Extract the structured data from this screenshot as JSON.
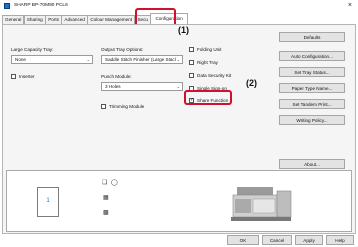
{
  "window": {
    "title": "SHARP BP-70M90 PCL6",
    "close": "×"
  },
  "tabs": [
    "General",
    "Sharing",
    "Ports",
    "Advanced",
    "Colour Management",
    "Secu",
    "Configuration"
  ],
  "left": {
    "large_capacity_label": "Large Capacity Tray:",
    "large_capacity_value": "None",
    "inserter_label": "Inserter"
  },
  "middle": {
    "output_label": "Output Tray Options:",
    "output_value": "Saddle Stitch Finisher (Large Stacl",
    "punch_label": "Punch Module:",
    "punch_value": "3 Holes",
    "trimming_label": "Trimming Module"
  },
  "checks": {
    "folding_unit": "Folding Unit",
    "right_tray": "Right Tray",
    "data_security": "Data Security Kit",
    "single_sign_on": "Single Sign-on",
    "share_function": "Share Function"
  },
  "buttons": {
    "defaults": "Defaults",
    "auto_config": "Auto Configuration...",
    "tray_status": "Set Tray Status...",
    "paper_type": "Paper Type Name...",
    "tandem": "Set Tandem Print...",
    "writing_policy": "Writing Policy...",
    "about": "About...",
    "ok": "OK",
    "cancel": "Cancel",
    "apply": "Apply",
    "help": "Help"
  },
  "callouts": {
    "one": "(1)",
    "two": "(2)"
  },
  "preview": {
    "page_number": "1"
  },
  "colors": {
    "highlight": "#d0102e",
    "accent": "#1f6fc4"
  }
}
